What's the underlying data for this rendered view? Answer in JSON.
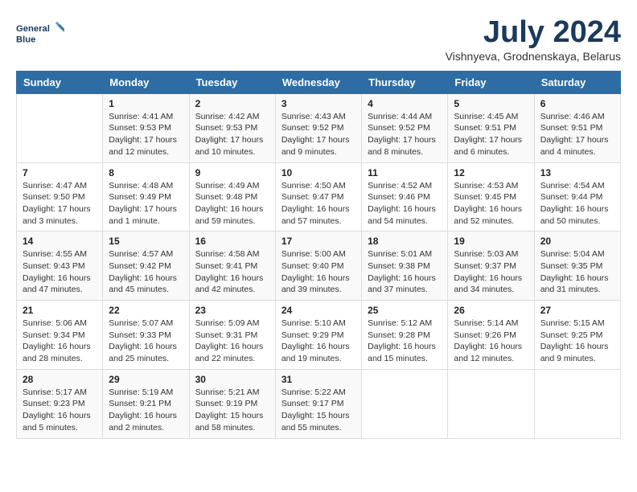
{
  "logo": {
    "line1": "General",
    "line2": "Blue"
  },
  "title": "July 2024",
  "location": "Vishnyeva, Grodnenskaya, Belarus",
  "headers": [
    "Sunday",
    "Monday",
    "Tuesday",
    "Wednesday",
    "Thursday",
    "Friday",
    "Saturday"
  ],
  "weeks": [
    [
      {
        "day": "",
        "info": ""
      },
      {
        "day": "1",
        "info": "Sunrise: 4:41 AM\nSunset: 9:53 PM\nDaylight: 17 hours\nand 12 minutes."
      },
      {
        "day": "2",
        "info": "Sunrise: 4:42 AM\nSunset: 9:53 PM\nDaylight: 17 hours\nand 10 minutes."
      },
      {
        "day": "3",
        "info": "Sunrise: 4:43 AM\nSunset: 9:52 PM\nDaylight: 17 hours\nand 9 minutes."
      },
      {
        "day": "4",
        "info": "Sunrise: 4:44 AM\nSunset: 9:52 PM\nDaylight: 17 hours\nand 8 minutes."
      },
      {
        "day": "5",
        "info": "Sunrise: 4:45 AM\nSunset: 9:51 PM\nDaylight: 17 hours\nand 6 minutes."
      },
      {
        "day": "6",
        "info": "Sunrise: 4:46 AM\nSunset: 9:51 PM\nDaylight: 17 hours\nand 4 minutes."
      }
    ],
    [
      {
        "day": "7",
        "info": "Sunrise: 4:47 AM\nSunset: 9:50 PM\nDaylight: 17 hours\nand 3 minutes."
      },
      {
        "day": "8",
        "info": "Sunrise: 4:48 AM\nSunset: 9:49 PM\nDaylight: 17 hours\nand 1 minute."
      },
      {
        "day": "9",
        "info": "Sunrise: 4:49 AM\nSunset: 9:48 PM\nDaylight: 16 hours\nand 59 minutes."
      },
      {
        "day": "10",
        "info": "Sunrise: 4:50 AM\nSunset: 9:47 PM\nDaylight: 16 hours\nand 57 minutes."
      },
      {
        "day": "11",
        "info": "Sunrise: 4:52 AM\nSunset: 9:46 PM\nDaylight: 16 hours\nand 54 minutes."
      },
      {
        "day": "12",
        "info": "Sunrise: 4:53 AM\nSunset: 9:45 PM\nDaylight: 16 hours\nand 52 minutes."
      },
      {
        "day": "13",
        "info": "Sunrise: 4:54 AM\nSunset: 9:44 PM\nDaylight: 16 hours\nand 50 minutes."
      }
    ],
    [
      {
        "day": "14",
        "info": "Sunrise: 4:55 AM\nSunset: 9:43 PM\nDaylight: 16 hours\nand 47 minutes."
      },
      {
        "day": "15",
        "info": "Sunrise: 4:57 AM\nSunset: 9:42 PM\nDaylight: 16 hours\nand 45 minutes."
      },
      {
        "day": "16",
        "info": "Sunrise: 4:58 AM\nSunset: 9:41 PM\nDaylight: 16 hours\nand 42 minutes."
      },
      {
        "day": "17",
        "info": "Sunrise: 5:00 AM\nSunset: 9:40 PM\nDaylight: 16 hours\nand 39 minutes."
      },
      {
        "day": "18",
        "info": "Sunrise: 5:01 AM\nSunset: 9:38 PM\nDaylight: 16 hours\nand 37 minutes."
      },
      {
        "day": "19",
        "info": "Sunrise: 5:03 AM\nSunset: 9:37 PM\nDaylight: 16 hours\nand 34 minutes."
      },
      {
        "day": "20",
        "info": "Sunrise: 5:04 AM\nSunset: 9:35 PM\nDaylight: 16 hours\nand 31 minutes."
      }
    ],
    [
      {
        "day": "21",
        "info": "Sunrise: 5:06 AM\nSunset: 9:34 PM\nDaylight: 16 hours\nand 28 minutes."
      },
      {
        "day": "22",
        "info": "Sunrise: 5:07 AM\nSunset: 9:33 PM\nDaylight: 16 hours\nand 25 minutes."
      },
      {
        "day": "23",
        "info": "Sunrise: 5:09 AM\nSunset: 9:31 PM\nDaylight: 16 hours\nand 22 minutes."
      },
      {
        "day": "24",
        "info": "Sunrise: 5:10 AM\nSunset: 9:29 PM\nDaylight: 16 hours\nand 19 minutes."
      },
      {
        "day": "25",
        "info": "Sunrise: 5:12 AM\nSunset: 9:28 PM\nDaylight: 16 hours\nand 15 minutes."
      },
      {
        "day": "26",
        "info": "Sunrise: 5:14 AM\nSunset: 9:26 PM\nDaylight: 16 hours\nand 12 minutes."
      },
      {
        "day": "27",
        "info": "Sunrise: 5:15 AM\nSunset: 9:25 PM\nDaylight: 16 hours\nand 9 minutes."
      }
    ],
    [
      {
        "day": "28",
        "info": "Sunrise: 5:17 AM\nSunset: 9:23 PM\nDaylight: 16 hours\nand 5 minutes."
      },
      {
        "day": "29",
        "info": "Sunrise: 5:19 AM\nSunset: 9:21 PM\nDaylight: 16 hours\nand 2 minutes."
      },
      {
        "day": "30",
        "info": "Sunrise: 5:21 AM\nSunset: 9:19 PM\nDaylight: 15 hours\nand 58 minutes."
      },
      {
        "day": "31",
        "info": "Sunrise: 5:22 AM\nSunset: 9:17 PM\nDaylight: 15 hours\nand 55 minutes."
      },
      {
        "day": "",
        "info": ""
      },
      {
        "day": "",
        "info": ""
      },
      {
        "day": "",
        "info": ""
      }
    ]
  ]
}
